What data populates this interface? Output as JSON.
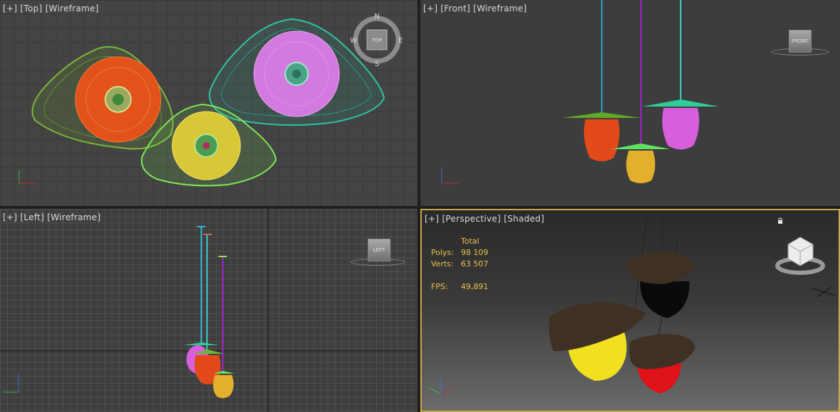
{
  "viewports": {
    "top": {
      "plus": "[+]",
      "name": "[Top]",
      "mode": "[Wireframe]"
    },
    "front": {
      "plus": "[+]",
      "name": "[Front]",
      "mode": "[Wireframe]"
    },
    "left": {
      "plus": "[+]",
      "name": "[Left]",
      "mode": "[Wireframe]"
    },
    "persp": {
      "plus": "[+]",
      "name": "[Perspective]",
      "mode": "[Shaded]"
    }
  },
  "viewcube": {
    "top_face": "TOP",
    "front_face": "FRONT",
    "left_face": "LEFT",
    "compass": {
      "n": "N",
      "s": "S",
      "e": "E",
      "w": "W"
    }
  },
  "stats": {
    "header": "Total",
    "polys_label": "Polys:",
    "polys_value": "98 109",
    "verts_label": "Verts:",
    "verts_value": "63 507",
    "fps_label": "FPS:",
    "fps_value": "49,891"
  },
  "axes": {
    "x": "x",
    "y": "y",
    "z": "z"
  },
  "colors": {
    "active_border": "#c7a94a",
    "stats_text": "#e8c24a",
    "lamp_orange": "#e04a1e",
    "lamp_yellow": "#e0b52c",
    "lamp_pink": "#d76bd8",
    "shade_green": "#7ab83a",
    "shade_teal": "#2fc3a2",
    "shade_lime": "#7ee857"
  },
  "icons": [
    "viewcube",
    "compass",
    "axis-tripod",
    "lock-icon"
  ]
}
